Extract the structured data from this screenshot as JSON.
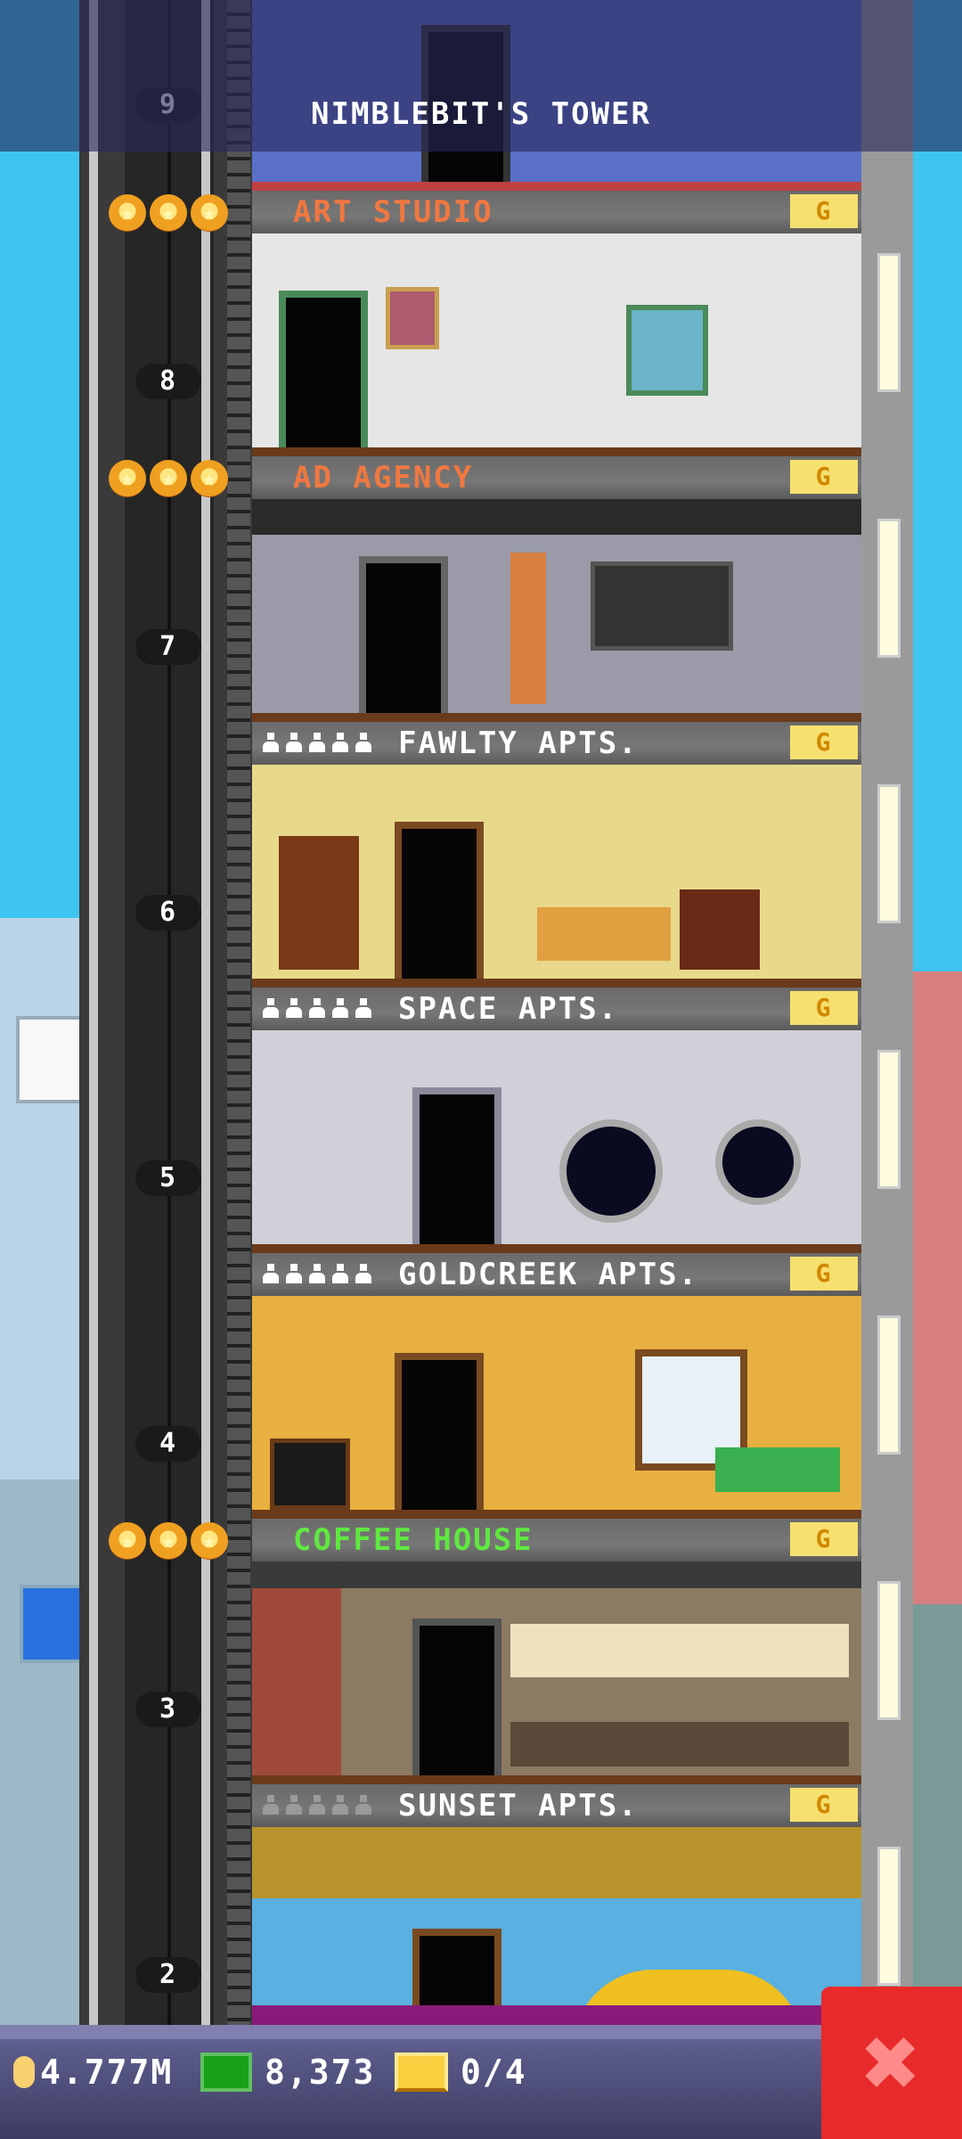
{
  "header": {
    "title": "NIMBLEBIT'S TOWER"
  },
  "top_floor_number": "9",
  "floors": [
    {
      "name": "ART STUDIO",
      "type": "business",
      "label_color": "#f07840",
      "stars": 3,
      "floor_number": "8",
      "room_color": "#e6e6e6",
      "g_label": "G"
    },
    {
      "name": "AD AGENCY",
      "type": "business",
      "label_color": "#f07840",
      "stars": 3,
      "floor_number": "7",
      "room_color": "#9a9aa8",
      "g_label": "G"
    },
    {
      "name": "FAWLTY APTS.",
      "type": "residential",
      "label_color": "#ffffff",
      "residents": 5,
      "residents_filled": true,
      "floor_number": "6",
      "room_color": "#e8d88a",
      "g_label": "G"
    },
    {
      "name": "SPACE APTS.",
      "type": "residential",
      "label_color": "#ffffff",
      "residents": 5,
      "residents_filled": true,
      "floor_number": "5",
      "room_color": "#cfd0d8",
      "g_label": "G"
    },
    {
      "name": "GOLDCREEK APTS.",
      "type": "residential",
      "label_color": "#ffffff",
      "residents": 5,
      "residents_filled": true,
      "floor_number": "4",
      "room_color": "#e8b040",
      "g_label": "G"
    },
    {
      "name": "COFFEE HOUSE",
      "type": "business",
      "label_color": "#60e840",
      "stars": 3,
      "floor_number": "3",
      "room_color": "#8c7a62",
      "g_label": "G"
    },
    {
      "name": "SUNSET APTS.",
      "type": "residential",
      "label_color": "#ffffff",
      "residents": 5,
      "residents_filled": false,
      "floor_number": "2",
      "room_color": "#5ab0e0",
      "g_label": "G"
    }
  ],
  "status": {
    "coins": "4.777M",
    "bux": "8,373",
    "golden_tickets": "0/4"
  },
  "colors": {
    "sky": "#3ec4f0",
    "close_button": "#e82a2a",
    "star": "#f0a020"
  }
}
